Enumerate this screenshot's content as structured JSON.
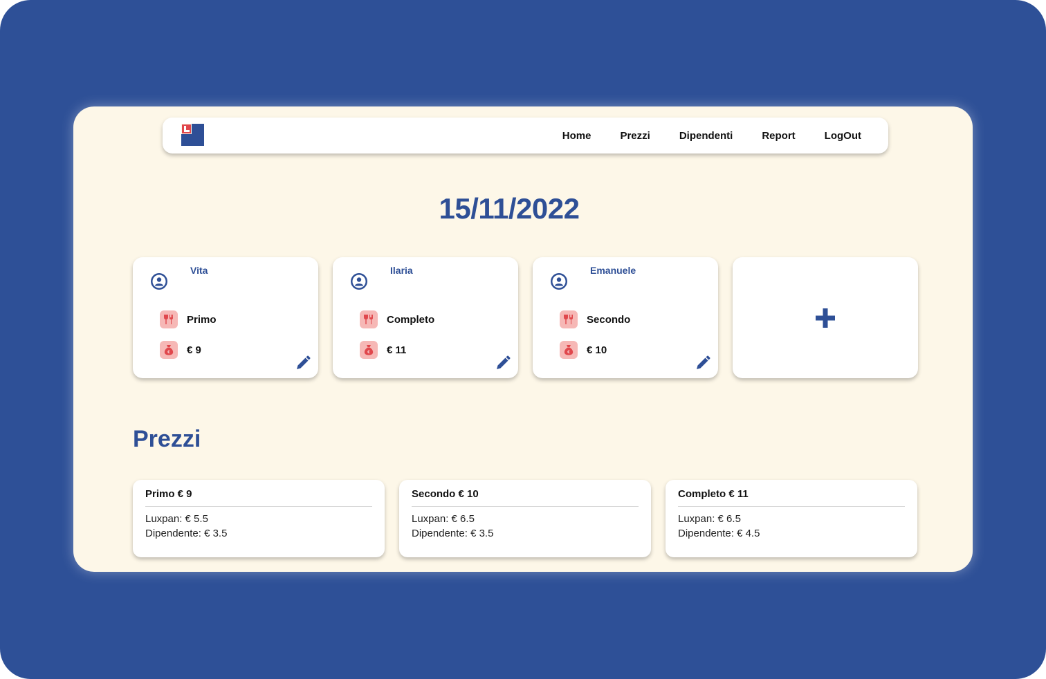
{
  "nav": {
    "links": [
      "Home",
      "Prezzi",
      "Dipendenti",
      "Report",
      "LogOut"
    ]
  },
  "date": "15/11/2022",
  "orders": [
    {
      "name": "Vita",
      "meal": "Primo",
      "price": "€ 9"
    },
    {
      "name": "Ilaria",
      "meal": "Completo",
      "price": "€ 11"
    },
    {
      "name": "Emanuele",
      "meal": "Secondo",
      "price": "€ 10"
    }
  ],
  "prices_section": {
    "title": "Prezzi",
    "cards": [
      {
        "title": "Primo € 9",
        "luxpan": "Luxpan: € 5.5",
        "dipendente": "Dipendente: € 3.5"
      },
      {
        "title": "Secondo € 10",
        "luxpan": "Luxpan: € 6.5",
        "dipendente": "Dipendente: € 3.5"
      },
      {
        "title": "Completo € 11",
        "luxpan": "Luxpan: € 6.5",
        "dipendente": "Dipendente: € 4.5"
      }
    ]
  },
  "icons": {
    "avatar": "user-circle-icon",
    "meal": "cutlery-icon",
    "price": "money-bag-icon",
    "edit": "pencil-icon",
    "add": "plus-icon"
  },
  "colors": {
    "background": "#2e5097",
    "panel": "#fdf7e8",
    "accent": "#2e4f96",
    "icon_bg": "#f6b8b6",
    "icon_fg": "#e0474c"
  }
}
